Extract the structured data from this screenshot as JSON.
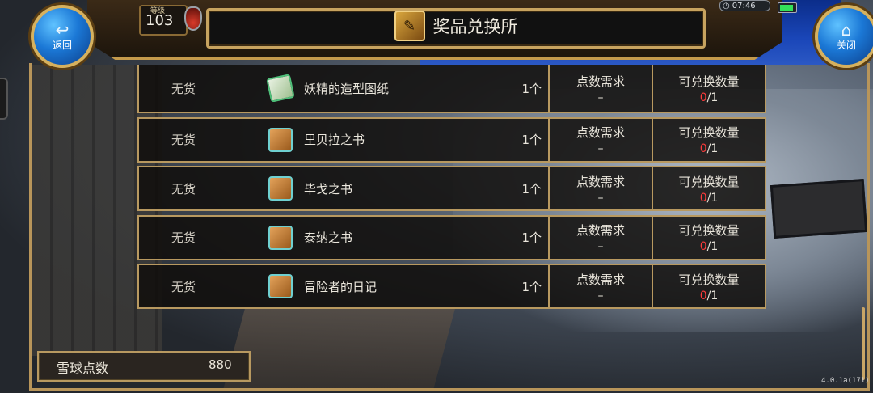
{
  "header": {
    "title": "奖品兑换所",
    "back_label": "返回",
    "close_label": "关闭",
    "level_label": "等级",
    "level_value": "103",
    "clock": "07:46"
  },
  "table": {
    "points_header": "点数需求",
    "exchange_header": "可兑换数量",
    "rows": [
      {
        "stock": "无货",
        "name": "妖精的造型图纸",
        "icon": "blueprint-icon",
        "qty": "1个",
        "points": "–",
        "used": "0",
        "limit": "/1"
      },
      {
        "stock": "无货",
        "name": "里贝拉之书",
        "icon": "book-icon",
        "qty": "1个",
        "points": "–",
        "used": "0",
        "limit": "/1"
      },
      {
        "stock": "无货",
        "name": "毕戈之书",
        "icon": "book-icon",
        "qty": "1个",
        "points": "–",
        "used": "0",
        "limit": "/1"
      },
      {
        "stock": "无货",
        "name": "泰纳之书",
        "icon": "book-icon",
        "qty": "1个",
        "points": "–",
        "used": "0",
        "limit": "/1"
      },
      {
        "stock": "无货",
        "name": "冒险者的日记",
        "icon": "book-icon",
        "qty": "1个",
        "points": "–",
        "used": "0",
        "limit": "/1"
      }
    ]
  },
  "footer": {
    "points_label": "雪球点数",
    "points_value": "880",
    "version": "4.0.1a(171)"
  },
  "colors": {
    "frame": "#b89960",
    "accent_red": "#ff3b3b",
    "button_blue": "#1b78d6"
  }
}
